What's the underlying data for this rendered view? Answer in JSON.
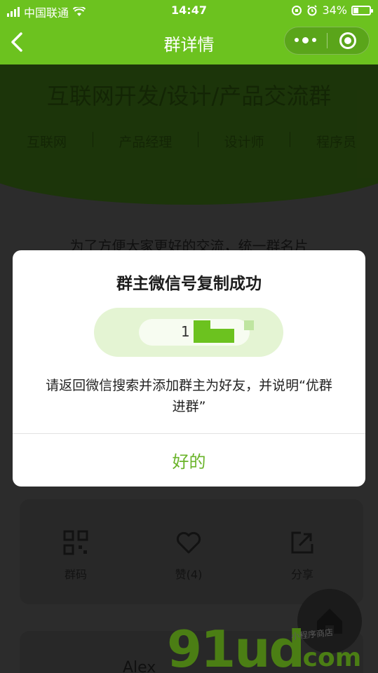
{
  "status": {
    "carrier": "中国联通",
    "time": "14:47",
    "battery": "34%",
    "battery_level": 0.34
  },
  "nav": {
    "title": "群详情"
  },
  "group": {
    "name": "互联网开发/设计/产品交流群",
    "tags": [
      "互联网",
      "产品经理",
      "设计师",
      "程序员"
    ],
    "notice": "为了方便大家更好的交流，统一群名片"
  },
  "actions": [
    {
      "label": "群码",
      "icon": "qrcode-icon"
    },
    {
      "label": "赞(4)",
      "icon": "heart-icon"
    },
    {
      "label": "分享",
      "icon": "share-icon"
    }
  ],
  "member": {
    "name": "Alex"
  },
  "watermark": {
    "main": "91ud",
    "domain": ".com",
    "sub": "小程序商店"
  },
  "modal": {
    "title": "群主微信号复制成功",
    "wechat_id_masked": "1",
    "desc": "请返回微信搜索并添加群主为好友，并说明“优群 进群”",
    "confirm": "好的"
  },
  "colors": {
    "accent": "#6cc21f",
    "confirm_text": "#6ab42a",
    "pill": "#e4f4d3"
  }
}
